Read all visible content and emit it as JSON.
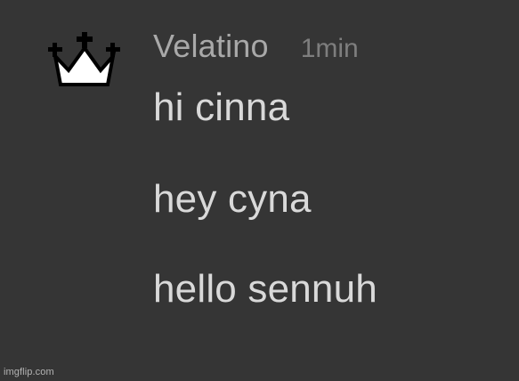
{
  "message_group": {
    "avatar_icon": "crown-icon",
    "username": "Velatino",
    "timestamp": "1min",
    "messages": [
      "hi cinna",
      "hey cyna",
      "hello sennuh"
    ]
  },
  "watermark": {
    "text": "imgflip.com"
  },
  "colors": {
    "background": "#353535",
    "username": "#a9a9a9",
    "timestamp": "#7e7e7e",
    "message_text": "#d9d9d9",
    "crown_fill": "#ffffff",
    "crown_outline": "#000000"
  }
}
